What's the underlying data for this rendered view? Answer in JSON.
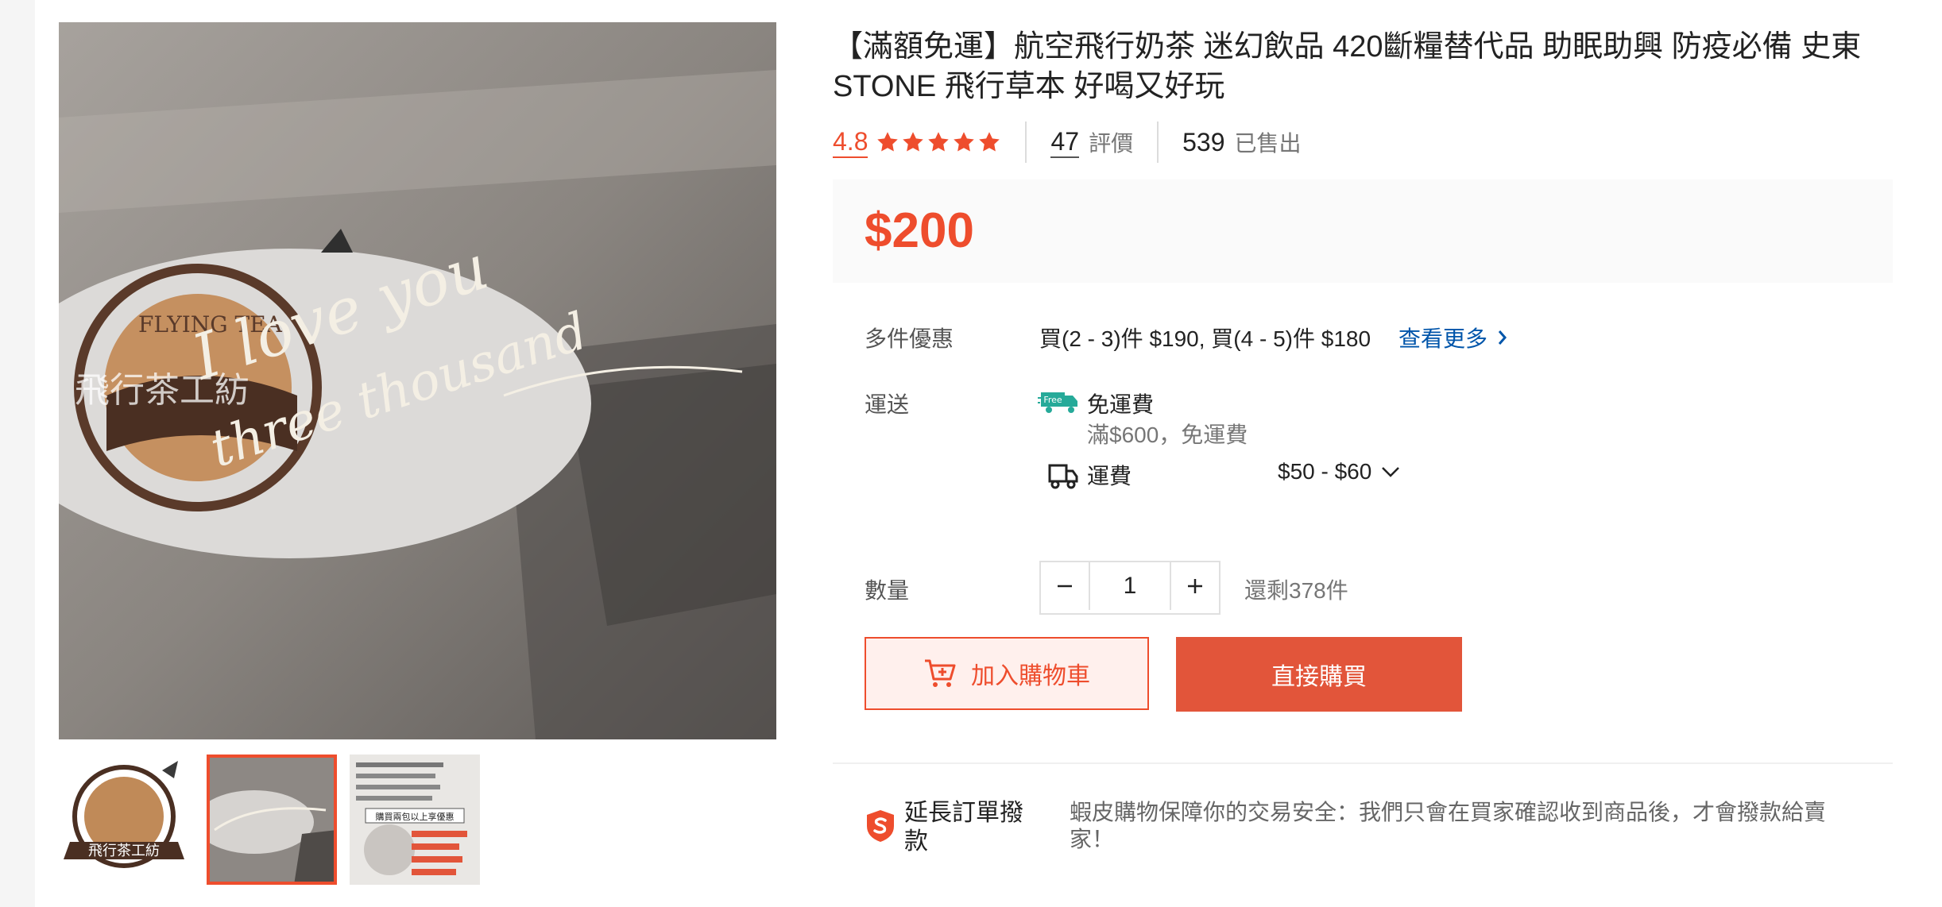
{
  "product": {
    "title": "【滿額免運】航空飛行奶茶 迷幻飲品 420斷糧替代品 助眠助興 防疫必備 史東STONE 飛行草本 好喝又好玩",
    "rating": "4.8",
    "stars": 5,
    "rating_count": "47",
    "rating_count_label": "評價",
    "sold_count": "539",
    "sold_label": "已售出",
    "price": "$200"
  },
  "gallery": {
    "main_image_script_line1": "I love you",
    "main_image_script_line2": "three thousand",
    "sticker_text": "FLYING TEA",
    "sticker_cn": "飛行茶工紡",
    "thumbnail_count": 3,
    "thumb3_headline": "購買兩包以上享優惠"
  },
  "bulk_discount": {
    "label": "多件優惠",
    "text": "買(2 - 3)件 $190, 買(4 - 5)件 $180",
    "see_more": "查看更多"
  },
  "shipping": {
    "label": "運送",
    "free_badge": "Free",
    "free_title": "免運費",
    "free_condition": "滿$600，免運費",
    "fee_label": "運費",
    "fee_range": "$50 - $60"
  },
  "quantity": {
    "label": "數量",
    "value": "1",
    "stock": "還剩378件"
  },
  "actions": {
    "add_to_cart": "加入購物車",
    "buy_now": "直接購買"
  },
  "guarantee": {
    "title": "延長訂單撥款",
    "text": "蝦皮購物保障你的交易安全：我們只會在買家確認收到商品後，才會撥款給賣家！"
  },
  "colors": {
    "accent": "#ee4d2d",
    "buy_button": "#e2553a",
    "link": "#0055aa",
    "free_badge": "#26aa99"
  }
}
